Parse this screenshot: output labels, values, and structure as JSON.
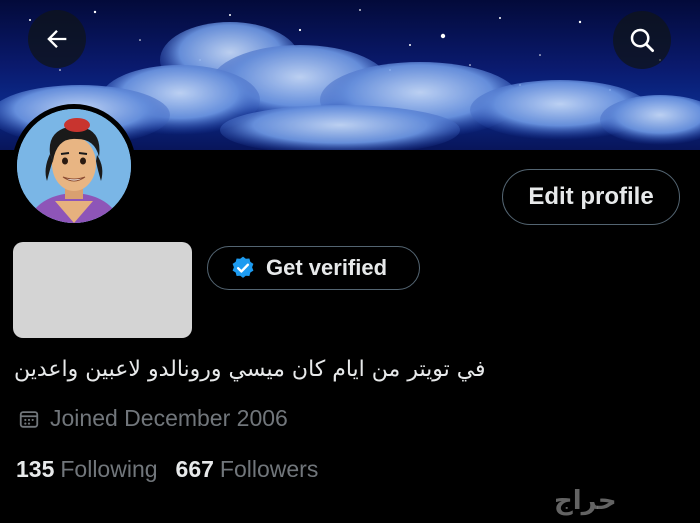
{
  "header": {
    "back_icon": "arrow-left-icon",
    "search_icon": "search-icon"
  },
  "profile": {
    "edit_label": "Edit profile",
    "verify_label": "Get verified",
    "bio": "في تويتر من ايام كان ميسي ورونالدو لاعبين واعدين",
    "joined": "Joined December 2006",
    "following_count": "135",
    "following_label": "Following",
    "followers_count": "667",
    "followers_label": "Followers"
  },
  "colors": {
    "background": "#000000",
    "text": "#e7e9ea",
    "muted": "#71767b",
    "border": "#536471",
    "verified_blue": "#1d9bf0"
  },
  "watermark": {
    "text": "حراج"
  }
}
